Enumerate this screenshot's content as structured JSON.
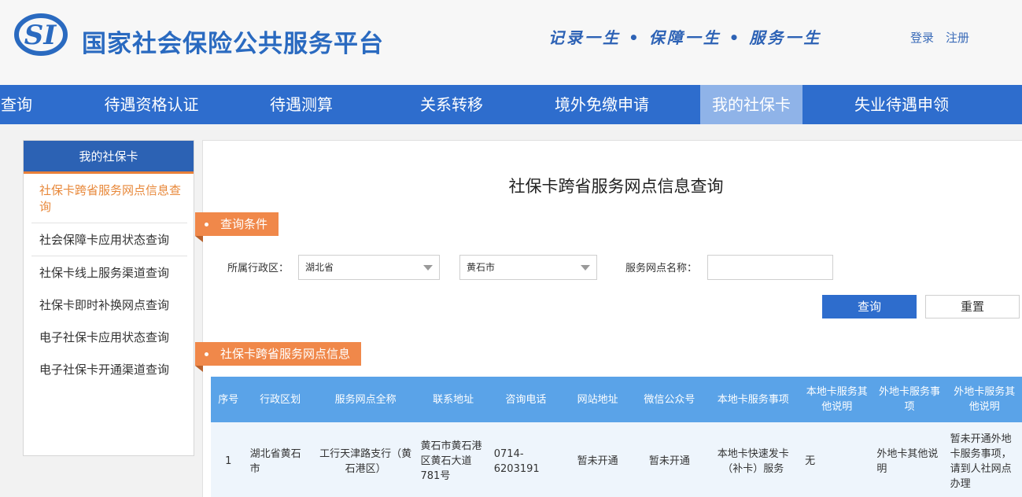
{
  "header": {
    "site_title": "国家社会保险公共服务平台",
    "slogan": "记录一生 • 保障一生 • 服务一生",
    "login": "登录",
    "register": "注册"
  },
  "nav": {
    "items": [
      {
        "label": "查询"
      },
      {
        "label": "待遇资格认证"
      },
      {
        "label": "待遇测算"
      },
      {
        "label": "关系转移"
      },
      {
        "label": "境外免缴申请"
      },
      {
        "label": "我的社保卡"
      },
      {
        "label": "失业待遇申领"
      }
    ],
    "active_index": 5
  },
  "sidebar": {
    "title": "我的社保卡",
    "items": [
      {
        "label": "社保卡跨省服务网点信息查询"
      },
      {
        "label": "社会保障卡应用状态查询"
      },
      {
        "label": "社保卡线上服务渠道查询"
      },
      {
        "label": "社保卡即时补换网点查询"
      },
      {
        "label": "电子社保卡应用状态查询"
      },
      {
        "label": "电子社保卡开通渠道查询"
      }
    ]
  },
  "main": {
    "page_title": "社保卡跨省服务网点信息查询",
    "query_section": "查询条件",
    "region_label": "所属行政区：",
    "province_value": "湖北省",
    "city_value": "黄石市",
    "outlet_name_label": "服务网点名称：",
    "outlet_name_value": "",
    "search_button": "查询",
    "reset_button": "重置",
    "result_section": "社保卡跨省服务网点信息"
  },
  "table": {
    "headers": [
      "序号",
      "行政区划",
      "服务网点全称",
      "联系地址",
      "咨询电话",
      "网站地址",
      "微信公众号",
      "本地卡服务事项",
      "本地卡服务其他说明",
      "外地卡服务事项",
      "外地卡服务其他说明"
    ],
    "rows": [
      [
        "1",
        "湖北省黄石市",
        "工行天津路支行（黄石港区）",
        "黄石市黄石港区黄石大道781号",
        "0714-6203191",
        "暂未开通",
        "暂未开通",
        "本地卡快速发卡（补卡）服务",
        "无",
        "外地卡其他说明",
        "暂未开通外地卡服务事项，请到人社网点办理"
      ]
    ]
  },
  "colors": {
    "brand_blue": "#2e6dcd",
    "nav_active": "#8fb3e8",
    "accent_orange": "#f0884a",
    "table_header": "#5aa3e8"
  }
}
